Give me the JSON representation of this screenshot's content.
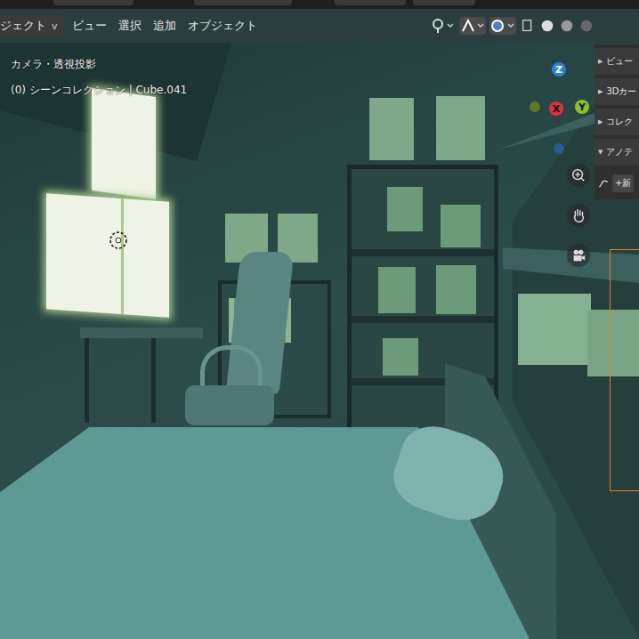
{
  "header": {
    "mode_menu": "ジェクト",
    "mode_caret": "v",
    "menus": [
      "ビュー",
      "選択",
      "追加",
      "オブジェクト"
    ]
  },
  "viewport": {
    "view_label": "カメラ・透視投影",
    "collection_label": "(0) シーンコレクション | Cube.041"
  },
  "gizmo": {
    "axes": [
      {
        "label": "Z",
        "color": "#2f7fd6"
      },
      {
        "label": "X",
        "color": "#d8313f"
      },
      {
        "label": "Y",
        "color": "#8bbf2a"
      }
    ]
  },
  "sidebar": {
    "panels": [
      {
        "label": "ビュー",
        "expanded": false,
        "arrow": "▶"
      },
      {
        "label": "3Dカー",
        "expanded": false,
        "arrow": "▶"
      },
      {
        "label": "コレク",
        "expanded": false,
        "arrow": "▶"
      },
      {
        "label": "アノテ",
        "expanded": true,
        "arrow": "▼"
      }
    ],
    "new_button": "+新"
  }
}
